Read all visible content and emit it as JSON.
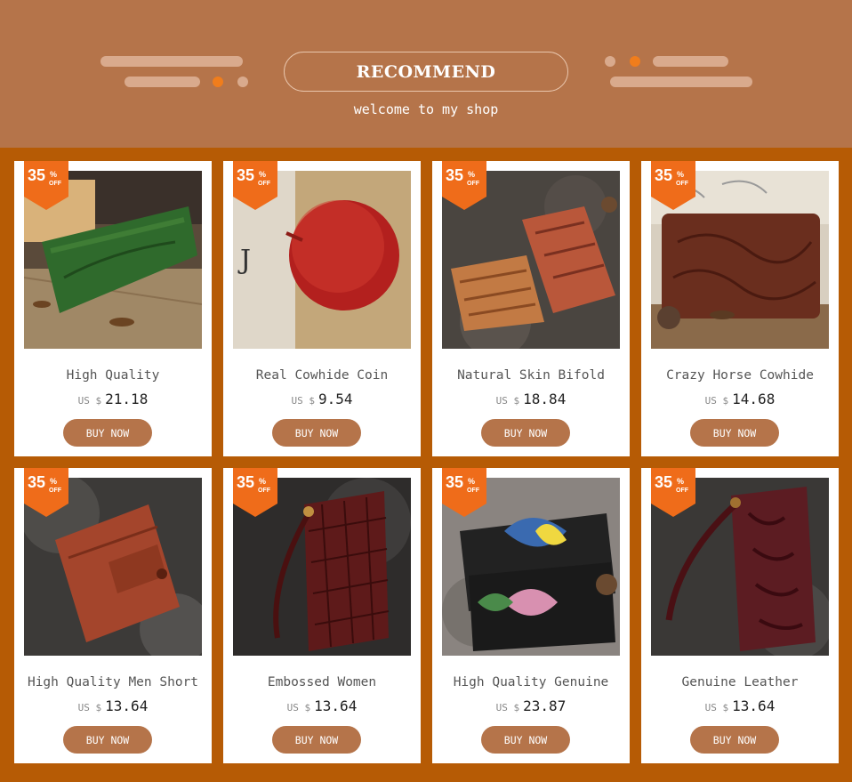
{
  "header": {
    "title": "RECOMMEND",
    "subtitle": "welcome to my shop",
    "accent_color": "#f07d1c",
    "bg_color": "#b5744a"
  },
  "discount_badge": {
    "value": "35",
    "percent": "%",
    "off": "OFF"
  },
  "buy_label": "BUY NOW",
  "currency": "US $",
  "products": [
    {
      "title": "High Quality",
      "price": "21.18",
      "image": "green-embossed-wallet"
    },
    {
      "title": "Real Cowhide Coin",
      "price": "9.54",
      "image": "red-round-coin-purse"
    },
    {
      "title": "Natural Skin Bifold",
      "price": "18.84",
      "image": "tan-engraved-wallets"
    },
    {
      "title": "Crazy Horse Cowhide",
      "price": "14.68",
      "image": "brown-floral-clutch"
    },
    {
      "title": "High Quality Men Short",
      "price": "13.64",
      "image": "red-trifold-wallet"
    },
    {
      "title": "Embossed Women",
      "price": "13.64",
      "image": "burgundy-quilted-wristlet"
    },
    {
      "title": "High Quality Genuine",
      "price": "23.87",
      "image": "black-lotus-wallet"
    },
    {
      "title": "Genuine Leather",
      "price": "13.64",
      "image": "burgundy-embossed-wristlet"
    }
  ]
}
